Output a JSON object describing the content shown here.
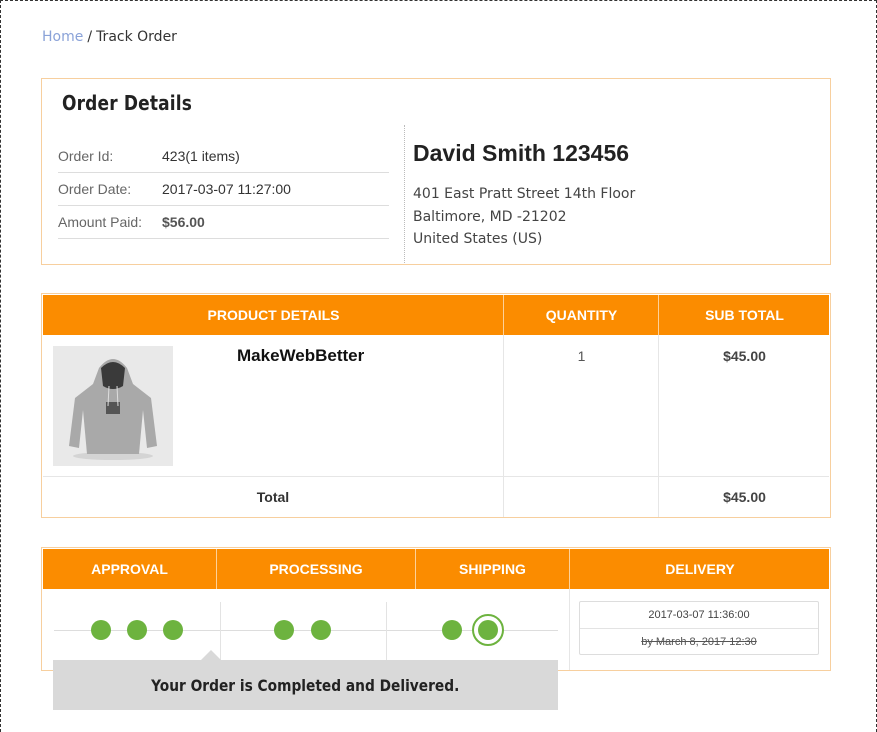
{
  "breadcrumb": {
    "home": "Home",
    "separator": "/",
    "current": "Track Order"
  },
  "order": {
    "title": "Order Details",
    "rows": [
      {
        "label": "Order Id:",
        "value": "423(1 items)"
      },
      {
        "label": "Order Date:",
        "value": "2017-03-07 11:27:00"
      },
      {
        "label": "Amount Paid:",
        "value": "$56.00"
      }
    ],
    "customer_name": "David Smith 123456",
    "address": [
      "401 East Pratt Street 14th Floor",
      "Baltimore, MD -21202",
      "United States (US)"
    ]
  },
  "products": {
    "headers": {
      "details": "PRODUCT DETAILS",
      "quantity": "QUANTITY",
      "subtotal": "SUB TOTAL"
    },
    "items": [
      {
        "name": "MakeWebBetter",
        "quantity": "1",
        "subtotal": "$45.00",
        "image": "hoodie-image"
      }
    ],
    "total_label": "Total",
    "total_value": "$45.00"
  },
  "tracking": {
    "steps": [
      "APPROVAL",
      "PROCESSING",
      "SHIPPING",
      "DELIVERY"
    ],
    "delivered_at": "2017-03-07 11:36:00",
    "expected": "by March 8, 2017 12:30",
    "message": "Your Order is Completed and Delivered."
  },
  "colors": {
    "accent": "#fb8c00",
    "progress": "#6db33f",
    "link": "#8aa2d8"
  }
}
